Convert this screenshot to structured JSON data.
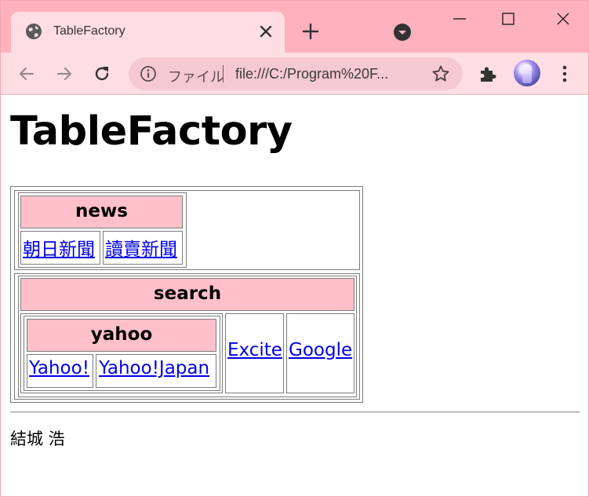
{
  "browser": {
    "tab_title": "TableFactory",
    "scheme_label": "ファイル",
    "url": "file:///C:/Program%20F...",
    "accent_color": "#ffb1be",
    "icons": [
      "globe-icon",
      "close-icon",
      "plus-icon",
      "tab-search-icon",
      "minimize-icon",
      "maximize-icon",
      "window-close-icon",
      "back-arrow-icon",
      "forward-arrow-icon",
      "reload-icon",
      "info-icon",
      "star-icon",
      "puzzle-icon",
      "kebab-menu-icon"
    ]
  },
  "page": {
    "title": "TableFactory",
    "news": {
      "header": "news",
      "links": [
        "朝日新聞",
        "讀賣新聞"
      ]
    },
    "search": {
      "header": "search",
      "yahoo": {
        "header": "yahoo",
        "links": [
          "Yahoo!",
          "Yahoo!Japan"
        ]
      },
      "links": [
        "Excite",
        "Google"
      ]
    },
    "header_bg_color": "#ffc0cb",
    "link_color": "#0000ee",
    "author": "結城 浩"
  }
}
